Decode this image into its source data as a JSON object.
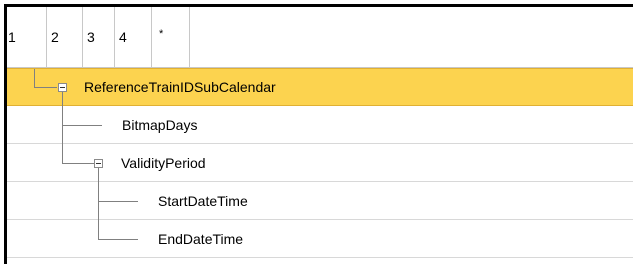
{
  "header": {
    "levels": [
      "1",
      "2",
      "3",
      "4",
      "*"
    ]
  },
  "tree": {
    "rows": [
      {
        "label": "ReferenceTrainIDSubCalendar",
        "selected": true,
        "expanded": true
      },
      {
        "label": "BitmapDays",
        "selected": false
      },
      {
        "label": "ValidityPeriod",
        "selected": false,
        "expanded": true
      },
      {
        "label": "StartDateTime",
        "selected": false
      },
      {
        "label": "EndDateTime",
        "selected": false
      }
    ]
  },
  "colors": {
    "selection": "#fcd34f",
    "tree_line": "#808080",
    "grid_line": "#d8d8d8"
  },
  "icons": {
    "expander": "minus-box-icon"
  }
}
